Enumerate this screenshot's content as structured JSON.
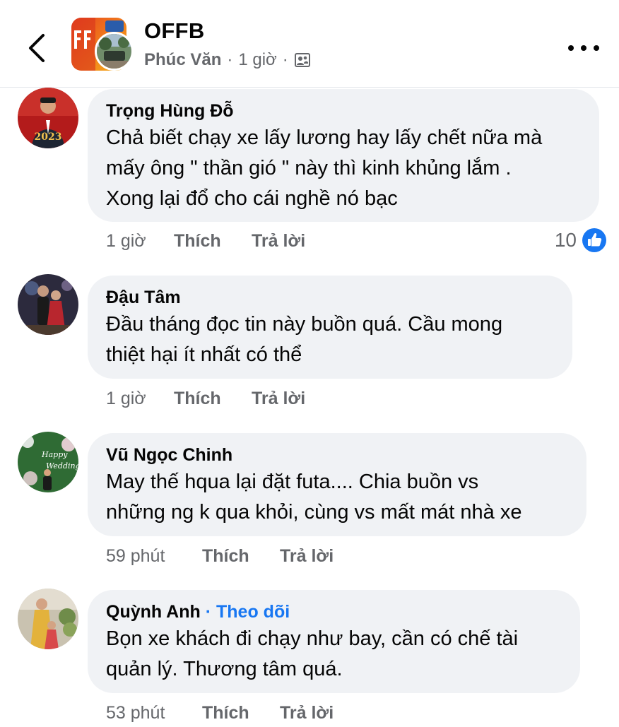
{
  "header": {
    "page_name": "OFFB",
    "author": "Phúc Văn",
    "separator": "·",
    "time": "1 giờ",
    "separator2": "·"
  },
  "comments": [
    {
      "name": "Trọng Hùng Đỗ",
      "text": "Chả biết chạy xe lấy lương hay lấy chết nữa mà\nmấy ông \" thần gió \" này thì kinh khủng lắm .\nXong lại đổ cho cái nghề nó bạc",
      "time": "1 giờ",
      "like_label": "Thích",
      "reply_label": "Trả lời",
      "reaction_count": "10"
    },
    {
      "name": "Đậu Tâm",
      "text": "Đầu tháng đọc tin này buồn quá.  Cầu mong\nthiệt hại ít nhất có thể",
      "time": "1 giờ",
      "like_label": "Thích",
      "reply_label": "Trả lời"
    },
    {
      "name": "Vũ Ngọc Chinh",
      "text": "May thế hqua lại đặt futa.... Chia buồn vs\nnhững ng k qua khỏi, cùng vs mất mát nhà xe",
      "time": "59 phút",
      "like_label": "Thích",
      "reply_label": "Trả lời"
    },
    {
      "name": "Quỳnh Anh",
      "name_separator": "·",
      "follow_label": "Theo dõi",
      "text": "Bọn xe khách đi chạy như bay, cần có chế tài\nquản lý. Thương tâm quá.",
      "time": "53 phút",
      "like_label": "Thích",
      "reply_label": "Trả lời"
    }
  ],
  "icons": {
    "back": "chevron-left-icon",
    "more": "more-horizontal-icon",
    "privacy": "members-icon",
    "like_reaction": "thumbs-up-icon"
  },
  "colors": {
    "accent": "#1877f2",
    "bubble": "#f0f2f5",
    "secondary_text": "#65676b"
  }
}
